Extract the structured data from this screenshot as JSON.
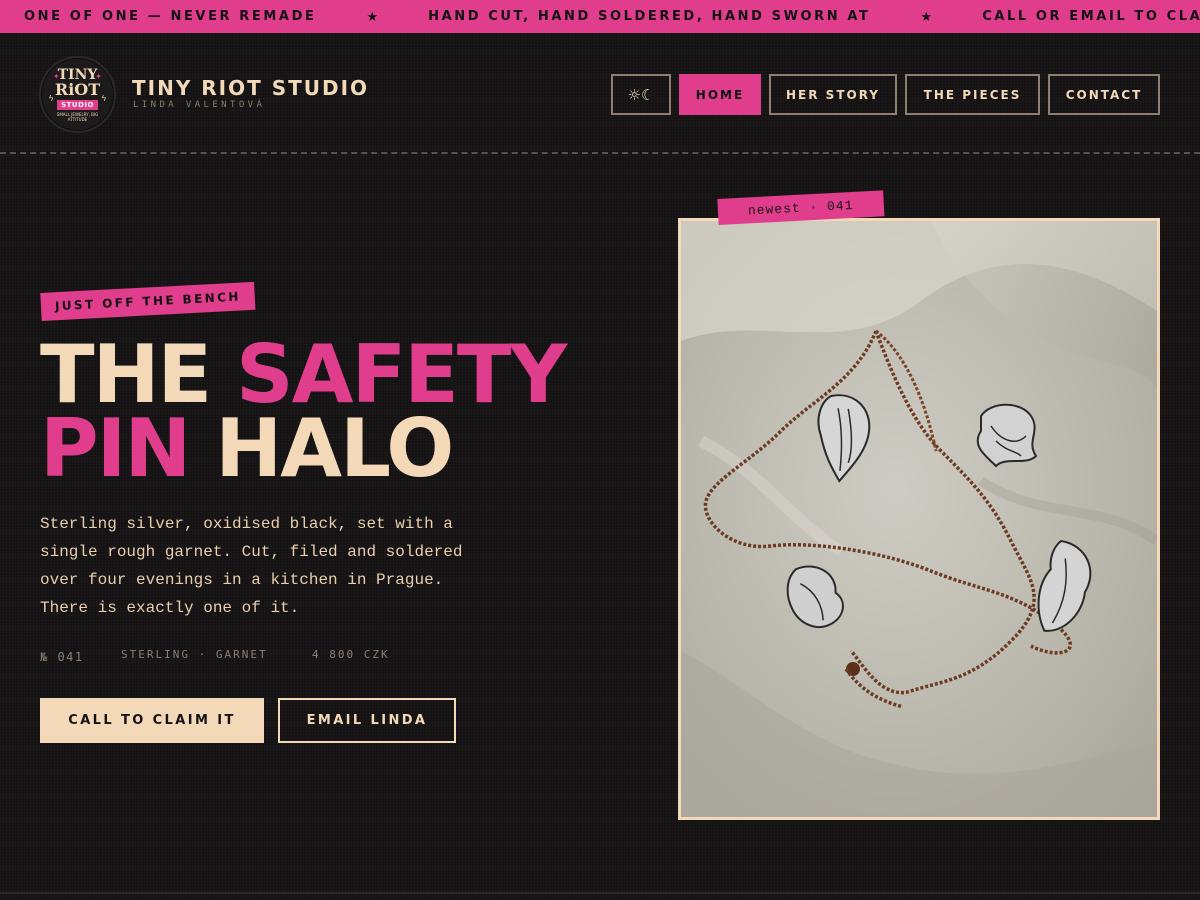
{
  "ticker": {
    "items": [
      "ONE OF ONE — NEVER REMADE",
      "HAND CUT, HAND SOLDERED, HAND SWORN AT",
      "CALL OR EMAIL TO CLAIM A"
    ],
    "separator": "★"
  },
  "brand": {
    "logo": {
      "line1": "TINY",
      "line2": "RiOT",
      "line3": "STUDIO",
      "line4": "SMALL JEWELRY, BIG ATTITUDE"
    },
    "title": "TINY RIOT STUDIO",
    "subtitle": "LINDA VALENTOVÁ"
  },
  "nav": {
    "theme_toggle": "☼☾",
    "items": [
      {
        "label": "HOME",
        "active": true
      },
      {
        "label": "HER STORY",
        "active": false
      },
      {
        "label": "THE PIECES",
        "active": false
      },
      {
        "label": "CONTACT",
        "active": false
      }
    ]
  },
  "hero": {
    "tag": "JUST OFF THE BENCH",
    "headline": {
      "line1_a": "THE",
      "line1_b": "SAFETY",
      "line2_a": "PIN",
      "line2_b": "HALO"
    },
    "description": "Sterling silver, oxidised black, set with a single rough garnet. Cut, filed and soldered over four evenings in a kitchen in Prague. There is exactly one of it.",
    "meta": {
      "number": "№ 041",
      "materials": "STERLING · GARNET",
      "price": "4 800 CZK"
    },
    "cta_primary": "CALL TO CLAIM IT",
    "cta_secondary": "EMAIL LINDA"
  },
  "photo": {
    "tag": "newest · 041"
  },
  "colors": {
    "background": "#141213",
    "accent_pink": "#e03d8c",
    "cream": "#f3d9b8",
    "muted": "#8d7f72"
  }
}
